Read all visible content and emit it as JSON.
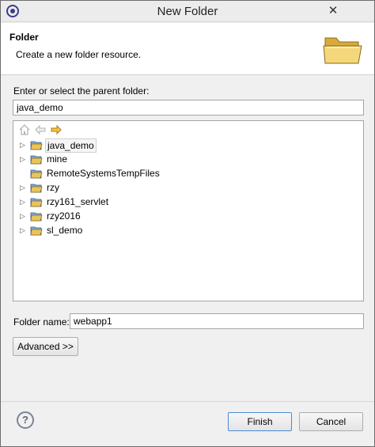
{
  "window": {
    "title": "New Folder"
  },
  "header": {
    "title": "Folder",
    "description": "Create a new folder resource."
  },
  "parent": {
    "label": "Enter or select the parent folder:",
    "value": "java_demo"
  },
  "tree": {
    "items": [
      {
        "label": "java_demo",
        "expandable": true,
        "selected": true
      },
      {
        "label": "mine",
        "expandable": true,
        "selected": false
      },
      {
        "label": "RemoteSystemsTempFiles",
        "expandable": false,
        "selected": false
      },
      {
        "label": "rzy",
        "expandable": true,
        "selected": false
      },
      {
        "label": "rzy161_servlet",
        "expandable": true,
        "selected": false
      },
      {
        "label": "rzy2016",
        "expandable": true,
        "selected": false
      },
      {
        "label": "sl_demo",
        "expandable": true,
        "selected": false
      }
    ]
  },
  "folder_name": {
    "label": "Folder name:",
    "value": "webapp1"
  },
  "buttons": {
    "advanced": "Advanced >>",
    "finish": "Finish",
    "cancel": "Cancel"
  },
  "icons": {
    "app": "eclipse-icon",
    "close": "close-icon",
    "home": "home-icon",
    "back": "back-arrow-icon",
    "forward": "forward-arrow-icon",
    "folder": "project-folder-icon",
    "help": "help-icon"
  },
  "colors": {
    "forward_arrow": "#e0a21e",
    "folder_yellow": "#e8c45a",
    "default_button_border": "#4a8ad6"
  }
}
